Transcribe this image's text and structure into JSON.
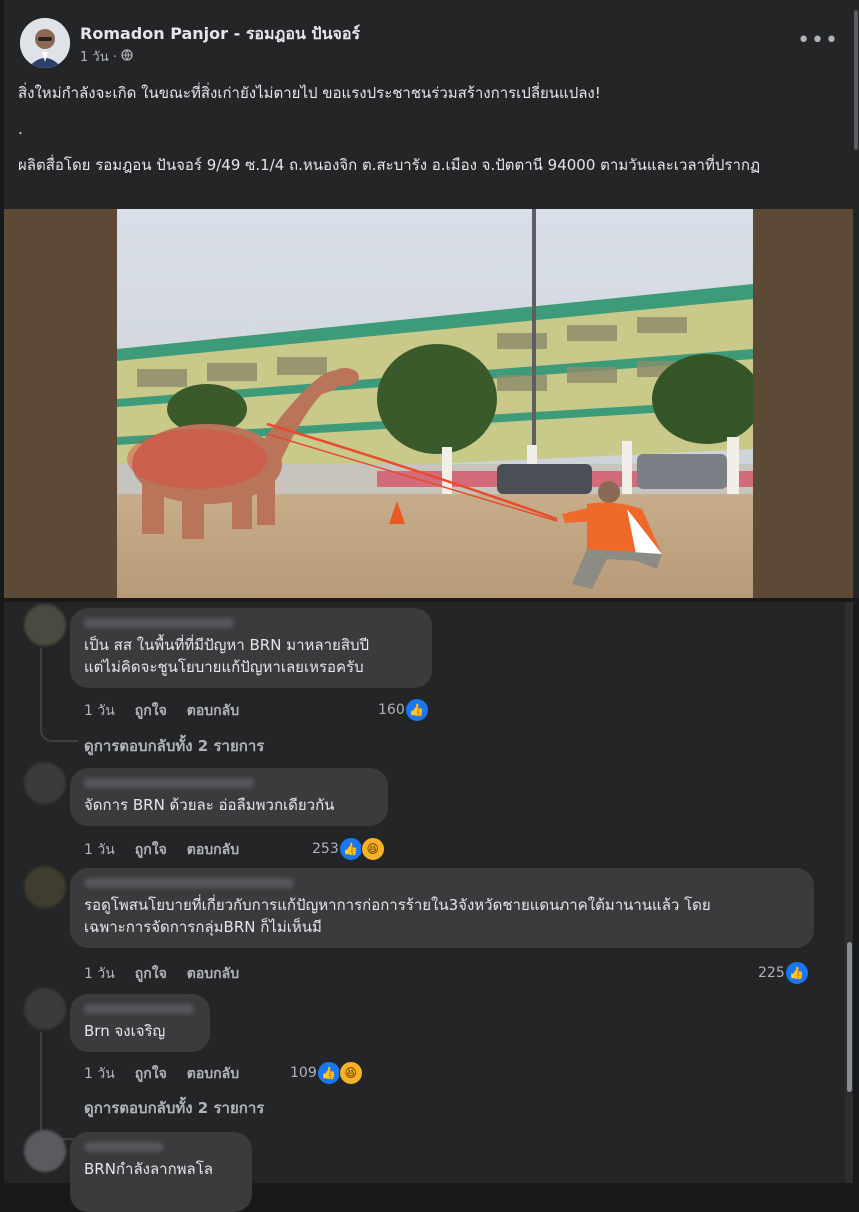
{
  "post": {
    "author": "Romadon Panjor - รอมฎอน ปันจอร์",
    "time": "1 วัน ·",
    "more": "•••",
    "text_line1": "สิ่งใหม่กำลังจะเกิด ในขณะที่สิ่งเก่ายังไม่ตายไป ขอแรงประชาชนร่วมสร้างการเปลี่ยนแปลง!",
    "text_line2": ".",
    "text_line3": "ผลิตสื่อโดย รอมฎอน ปันจอร์ 9/49 ซ.1/4 ถ.หนองจิก ต.สะบารัง อ.เมือง จ.ปัตตานี 94000 ตามวันและเวลาที่ปรากฏ"
  },
  "comments": [
    {
      "text": "เป็น สส ในพื้นที่ที่มีปัญหา BRN มาหลายสิบปี\nแต่ไม่คิดจะชูนโยบายแก้ปัญหาเลยเหรอครับ",
      "time": "1 วัน",
      "like": "ถูกใจ",
      "reply": "ตอบกลับ",
      "count": "160",
      "view_replies": "ดูการตอบกลับทั้ง 2 รายการ"
    },
    {
      "text": "จัดการ BRN ด้วยละ อ่อลืมพวกเดียวกัน",
      "time": "1 วัน",
      "like": "ถูกใจ",
      "reply": "ตอบกลับ",
      "count": "253"
    },
    {
      "text": "รอดูโพสนโยบายที่เกี่ยวกับการแก้ปัญหาการก่อการร้ายใน3จังหวัดชายแดนภาคใต้มานานแล้ว โดย\nเฉพาะการจัดการกลุ่มBRN ก็ไม่เห็นมี",
      "time": "1 วัน",
      "like": "ถูกใจ",
      "reply": "ตอบกลับ",
      "count": "225"
    },
    {
      "text": "Brn จงเจริญ",
      "time": "1 วัน",
      "like": "ถูกใจ",
      "reply": "ตอบกลับ",
      "count": "109",
      "view_replies": "ดูการตอบกลับทั้ง 2 รายการ"
    },
    {
      "text": "BRNกำลังลากพลโล"
    }
  ],
  "colors": {
    "bg": "#18191a",
    "card": "#242526",
    "bubble": "#3a3b3c",
    "like": "#1877f2",
    "haha": "#f7b125"
  },
  "icons": {
    "more": "more-dots-icon",
    "privacy": "globe-icon",
    "like": "like-icon",
    "haha": "haha-icon"
  }
}
